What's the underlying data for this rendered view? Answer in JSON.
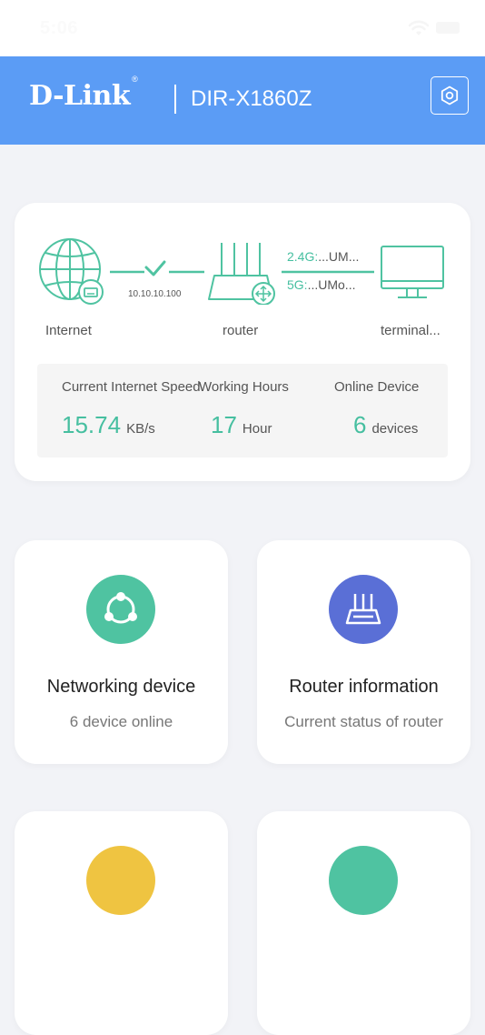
{
  "status_bar": {
    "time": "5:06"
  },
  "header": {
    "logo": "D-Link",
    "logo_mark": "®",
    "model": "DIR-X1860Z"
  },
  "topology": {
    "internet_label": "Internet",
    "router_label": "router",
    "terminal_label": "terminal...",
    "wan_ip": "10.10.10.100",
    "band_24_key": "2.4G:",
    "band_24_ssid": "...UM...",
    "band_5_key": "5G:",
    "band_5_ssid": "...UMo..."
  },
  "stats": {
    "speed": {
      "title": "Current Internet Speed",
      "value": "15.74",
      "unit": "KB/s"
    },
    "hours": {
      "title": "Working Hours",
      "value": "17",
      "unit": "Hour"
    },
    "devices": {
      "title": "Online Device",
      "value": "6",
      "unit": "devices"
    }
  },
  "features": [
    {
      "title": "Networking device",
      "subtitle": "6 device online",
      "color": "#4fc3a1"
    },
    {
      "title": "Router information",
      "subtitle": "Current status of router",
      "color": "#5a6fd6"
    },
    {
      "color": "#efc441"
    },
    {
      "color": "#4fc3a1"
    }
  ],
  "colors": {
    "header": "#5b9cf5",
    "accent": "#46bfa0"
  }
}
